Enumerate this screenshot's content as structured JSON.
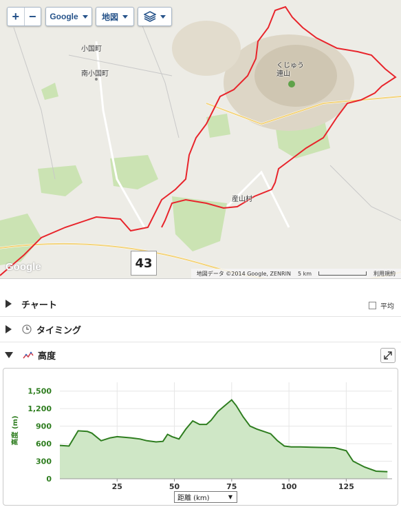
{
  "map": {
    "zoom_in": "+",
    "zoom_out": "−",
    "provider_select": "Google",
    "maptype_select": "地図",
    "layers_icon": "layers-icon",
    "place_labels": [
      "小国町",
      "南小国町",
      "くじゅう連山",
      "産山村"
    ],
    "thumbnail_text": "43",
    "logo": "Google",
    "attribution": "地図データ ©2014 Google, ZENRIN",
    "scale_label": "5 km",
    "terms": "利用規約",
    "route_color": "#e8242b"
  },
  "sections": {
    "chart": "チャート",
    "average": "平均",
    "timing": "タイミング",
    "elevation": "高度"
  },
  "chart_data": {
    "type": "area",
    "ylabel": "高度 (m)",
    "xlabel": "距離 (km)",
    "x_select_label": "距離 (km)",
    "yticks": [
      "0",
      "300",
      "600",
      "900",
      "1,200",
      "1,500"
    ],
    "xticks": [
      "25",
      "50",
      "75",
      "100",
      "125"
    ],
    "ylim": [
      0,
      1650
    ],
    "xlim": [
      0,
      145
    ],
    "grid": true,
    "fill_color": "#cfe7c6",
    "line_color": "#2e7d1f",
    "x": [
      0,
      4,
      8,
      12,
      14,
      18,
      22,
      25,
      28,
      31,
      35,
      38,
      42,
      45,
      47,
      49,
      52,
      55,
      58,
      61,
      64,
      66,
      69,
      72,
      75,
      77,
      80,
      83,
      86,
      89,
      92,
      95,
      98,
      101,
      105,
      110,
      115,
      120,
      125,
      128,
      133,
      138,
      143
    ],
    "y": [
      570,
      560,
      820,
      810,
      780,
      650,
      700,
      720,
      710,
      700,
      680,
      650,
      630,
      640,
      760,
      720,
      680,
      850,
      990,
      930,
      930,
      1000,
      1150,
      1250,
      1350,
      1250,
      1060,
      900,
      850,
      810,
      770,
      650,
      560,
      545,
      545,
      540,
      535,
      530,
      480,
      300,
      200,
      130,
      120
    ]
  }
}
